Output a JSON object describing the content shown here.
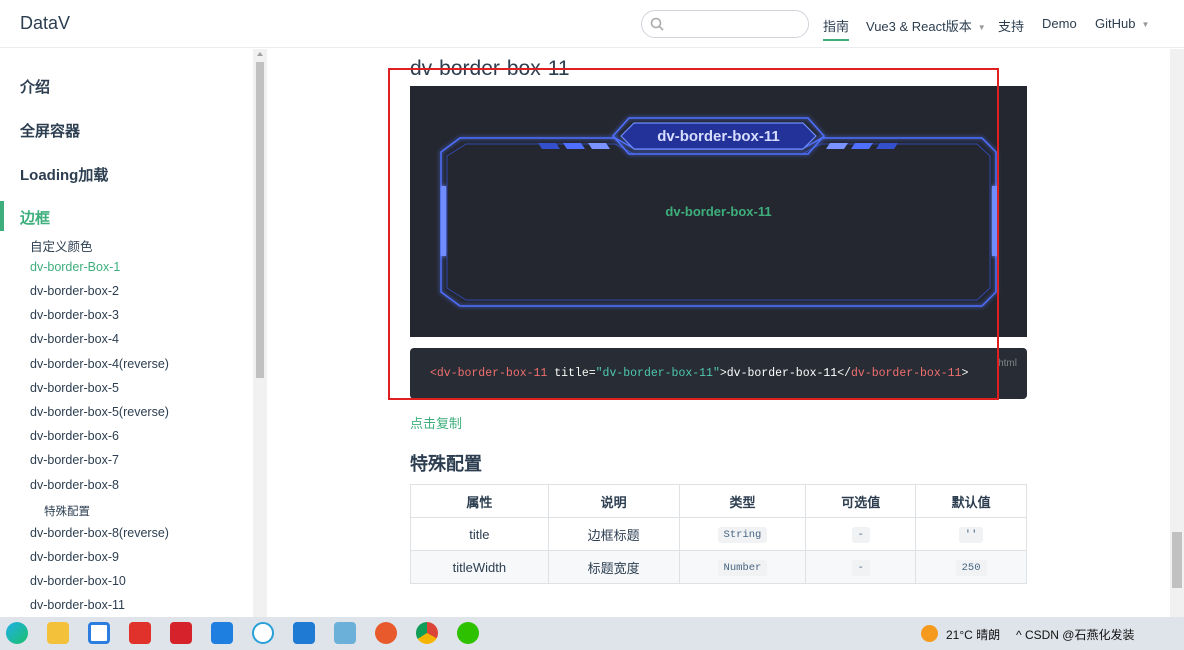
{
  "header": {
    "logo": "DataV",
    "search_placeholder": "",
    "nav": [
      {
        "label": "指南"
      },
      {
        "label": "Vue3 & React版本"
      },
      {
        "label": "支持"
      },
      {
        "label": "Demo"
      },
      {
        "label": "GitHub"
      }
    ]
  },
  "sidebar": {
    "sections": [
      {
        "label": "介绍"
      },
      {
        "label": "全屏容器"
      },
      {
        "label": "Loading加载"
      },
      {
        "label": "边框"
      }
    ],
    "items": [
      {
        "label": "自定义颜色"
      },
      {
        "label": "dv-border-Box-1"
      },
      {
        "label": "dv-border-box-2"
      },
      {
        "label": "dv-border-box-3"
      },
      {
        "label": "dv-border-box-4"
      },
      {
        "label": "dv-border-box-4(reverse)"
      },
      {
        "label": "dv-border-box-5"
      },
      {
        "label": "dv-border-box-5(reverse)"
      },
      {
        "label": "dv-border-box-6"
      },
      {
        "label": "dv-border-box-7"
      },
      {
        "label": "dv-border-box-8"
      },
      {
        "label": "特殊配置"
      },
      {
        "label": "dv-border-box-8(reverse)"
      },
      {
        "label": "dv-border-box-9"
      },
      {
        "label": "dv-border-box-10"
      },
      {
        "label": "dv-border-box-11"
      }
    ]
  },
  "main": {
    "heading": "dv-border-box-11",
    "demo": {
      "box_title": "dv-border-box-11",
      "content": "dv-border-box-11"
    },
    "code": {
      "lang": "html",
      "open_tag": "<dv-border-box-11",
      "attr_name": " title=",
      "attr_value": "\"dv-border-box-11\"",
      "close_bracket": ">",
      "inner_text": "dv-border-box-11",
      "end_open": "</",
      "end_tag": "dv-border-box-11",
      "end_close": ">"
    },
    "copy_label": "点击复制",
    "config_heading": "特殊配置",
    "table": {
      "headers": [
        "属性",
        "说明",
        "类型",
        "可选值",
        "默认值"
      ],
      "rows": [
        [
          "title",
          "边框标题",
          "String",
          "-",
          "''"
        ],
        [
          "titleWidth",
          "标题宽度",
          "Number",
          "-",
          "250"
        ]
      ]
    }
  },
  "taskbar": {
    "weather": "21°C 晴朗",
    "tray_text": "^ CSDN @石燕化发装"
  },
  "colors": {
    "accent": "#3eaf7c",
    "demo_bg": "#24272f",
    "code_bg": "#282c34",
    "annotation": "#e02020"
  }
}
